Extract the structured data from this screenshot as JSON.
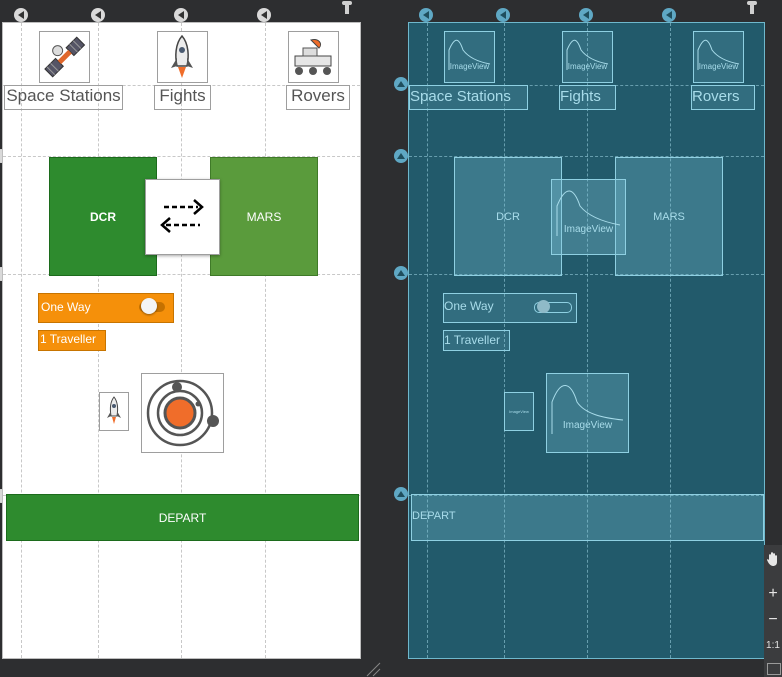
{
  "design": {
    "tabs": [
      {
        "label": "Space Stations",
        "icon": "satellite-icon"
      },
      {
        "label": "Fights",
        "icon": "rocket-icon"
      },
      {
        "label": "Rovers",
        "icon": "rover-icon"
      }
    ],
    "origin": "DCR",
    "destination": "MARS",
    "swap_icon": "swap-arrows-icon",
    "one_way_label": "One Way",
    "one_way_on": false,
    "traveller_label": "1 Traveller",
    "small_icon": "rocket-icon",
    "planet_icon": "solar-system-icon",
    "depart_label": "DEPART",
    "colors": {
      "green_dark": "#2e8b2e",
      "green_light": "#5a9b3c",
      "orange": "#f5900a",
      "blueprint_bg": "#225a6b"
    }
  },
  "blueprint": {
    "image_view_label": "ImageView",
    "tab_labels": [
      "Space Stations",
      "Fights",
      "Rovers"
    ],
    "origin": "DCR",
    "destination": "MARS",
    "center_label": "ImageView",
    "one_way_label": "One Way",
    "traveller_label": "1 Traveller",
    "small_image_label": "ImageView",
    "planet_label": "ImageView",
    "depart_label": "DEPART"
  },
  "zoom": {
    "zoom_in": "+",
    "zoom_out": "−",
    "fit": "1:1"
  }
}
